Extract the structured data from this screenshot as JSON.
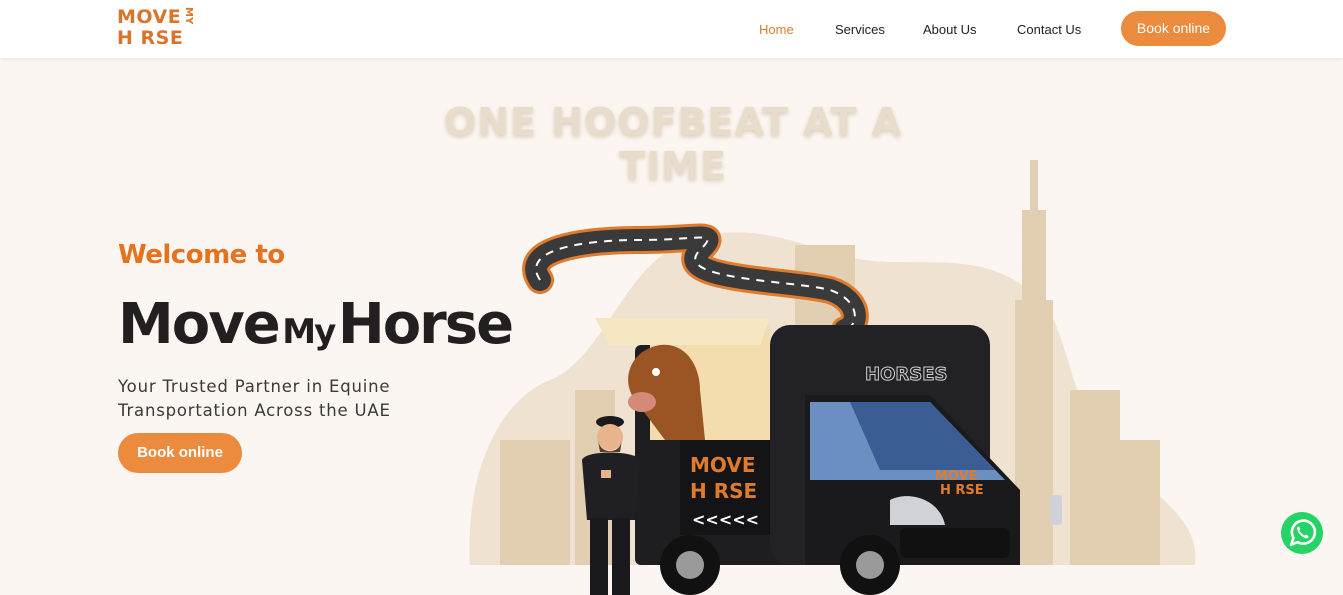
{
  "header": {
    "logo": {
      "line1": "MOVE",
      "line2": "H RSE",
      "vertical": "MY"
    },
    "nav": [
      {
        "label": "Home",
        "active": true
      },
      {
        "label": "Services",
        "active": false
      },
      {
        "label": "About Us",
        "active": false
      },
      {
        "label": "Contact Us",
        "active": false
      }
    ],
    "book_label": "Book online"
  },
  "hero": {
    "tagline": "ONE HOOFBEAT AT A TIME",
    "welcome": "Welcome to",
    "brand_move": "Move",
    "brand_my": "My",
    "brand_horse": "Horse",
    "subtitle": "Your Trusted Partner in Equine Transportation Across the UAE",
    "book_label": "Book online"
  },
  "illustration": {
    "truck_label": "HORSES",
    "truck_logo_line1": "MOVE",
    "truck_logo_line2": "H RSE",
    "truck_logo_my": "MY"
  },
  "colors": {
    "accent": "#ec8a3d",
    "accent_text": "#e6721d",
    "dark": "#231f20",
    "background": "#fbf6f1"
  },
  "icons": {
    "whatsapp": "whatsapp-icon"
  }
}
